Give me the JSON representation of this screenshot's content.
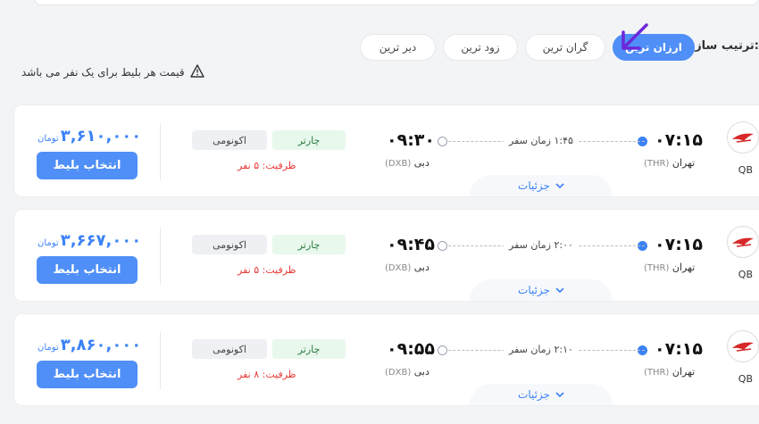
{
  "header": {
    "sort_label": "ترتیب سازی:",
    "sort_options": [
      {
        "label": "ارزان ترین",
        "active": true
      },
      {
        "label": "گران ترین",
        "active": false
      },
      {
        "label": "زود ترین",
        "active": false
      },
      {
        "label": "دیر ترین",
        "active": false
      }
    ],
    "price_note": "قیمت هر بلیط برای یک نفر می باشد",
    "note_icon": "warning-triangle-icon",
    "arrow_color": "#6d28d9"
  },
  "flights": [
    {
      "airline_code": "QB",
      "dep_time": "۰۷:۱۵",
      "dep_city": "تهران",
      "dep_airport": "(THR)",
      "duration": "۱:۴۵ زمان سفر",
      "arr_time": "۰۹:۳۰",
      "arr_city": "دبی",
      "arr_airport": "(DXB)",
      "details": "جزئیات",
      "charter": "چارتر",
      "cabin": "اکونومی",
      "capacity": "ظرفیت: ۵ نفر",
      "price": "۳,۶۱۰,۰۰۰",
      "currency": "تومان",
      "select": "انتخاب بلیط"
    },
    {
      "airline_code": "QB",
      "dep_time": "۰۷:۱۵",
      "dep_city": "تهران",
      "dep_airport": "(THR)",
      "duration": "۲:۰۰ زمان سفر",
      "arr_time": "۰۹:۴۵",
      "arr_city": "دبی",
      "arr_airport": "(DXB)",
      "details": "جزئیات",
      "charter": "چارتر",
      "cabin": "اکونومی",
      "capacity": "ظرفیت: ۵ نفر",
      "price": "۳,۶۶۷,۰۰۰",
      "currency": "تومان",
      "select": "انتخاب بلیط"
    },
    {
      "airline_code": "QB",
      "dep_time": "۰۷:۱۵",
      "dep_city": "تهران",
      "dep_airport": "(THR)",
      "duration": "۲:۱۰ زمان سفر",
      "arr_time": "۰۹:۵۵",
      "arr_city": "دبی",
      "arr_airport": "(DXB)",
      "details": "جزئیات",
      "charter": "چارتر",
      "cabin": "اکونومی",
      "capacity": "ظرفیت: ۸ نفر",
      "price": "۳,۸۶۰,۰۰۰",
      "currency": "تومان",
      "select": "انتخاب بلیط"
    }
  ]
}
